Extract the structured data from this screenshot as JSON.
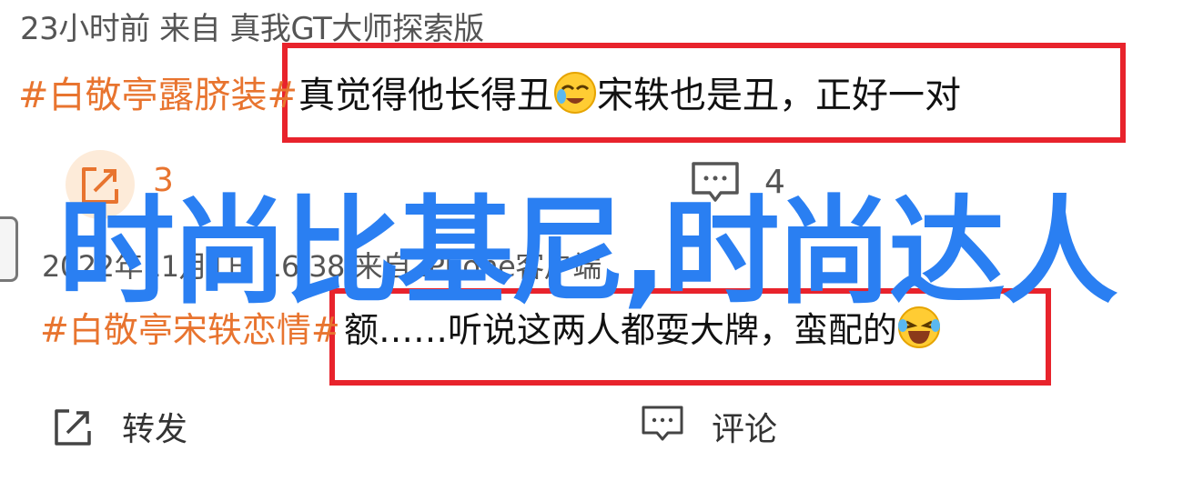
{
  "post1": {
    "meta": "23小时前 来自 真我GT大师探索版",
    "tag": "#白敬亭露脐装#",
    "text_before_emoji": "真觉得他长得丑",
    "text_after_emoji": "宋轶也是丑，正好一对",
    "emoji": "smiling-with-tears-emoji",
    "share_count": "3",
    "comment_count": "4"
  },
  "post2": {
    "meta": "2022年11月1日 16:38 来自 iPhone客户端",
    "tag": "#白敬亭宋轶恋情#",
    "text": "额……听说这两人都耍大牌，蛮配的",
    "emoji": "laughing-with-tears-emoji"
  },
  "overlay": {
    "title": "时尚比基尼,时尚达人"
  },
  "actions": {
    "repost_label": "转发",
    "comment_label": "评论"
  },
  "colors": {
    "tag": "#e8742f",
    "highlight_box": "#e8232c",
    "overlay_title": "#2a7ff2"
  }
}
